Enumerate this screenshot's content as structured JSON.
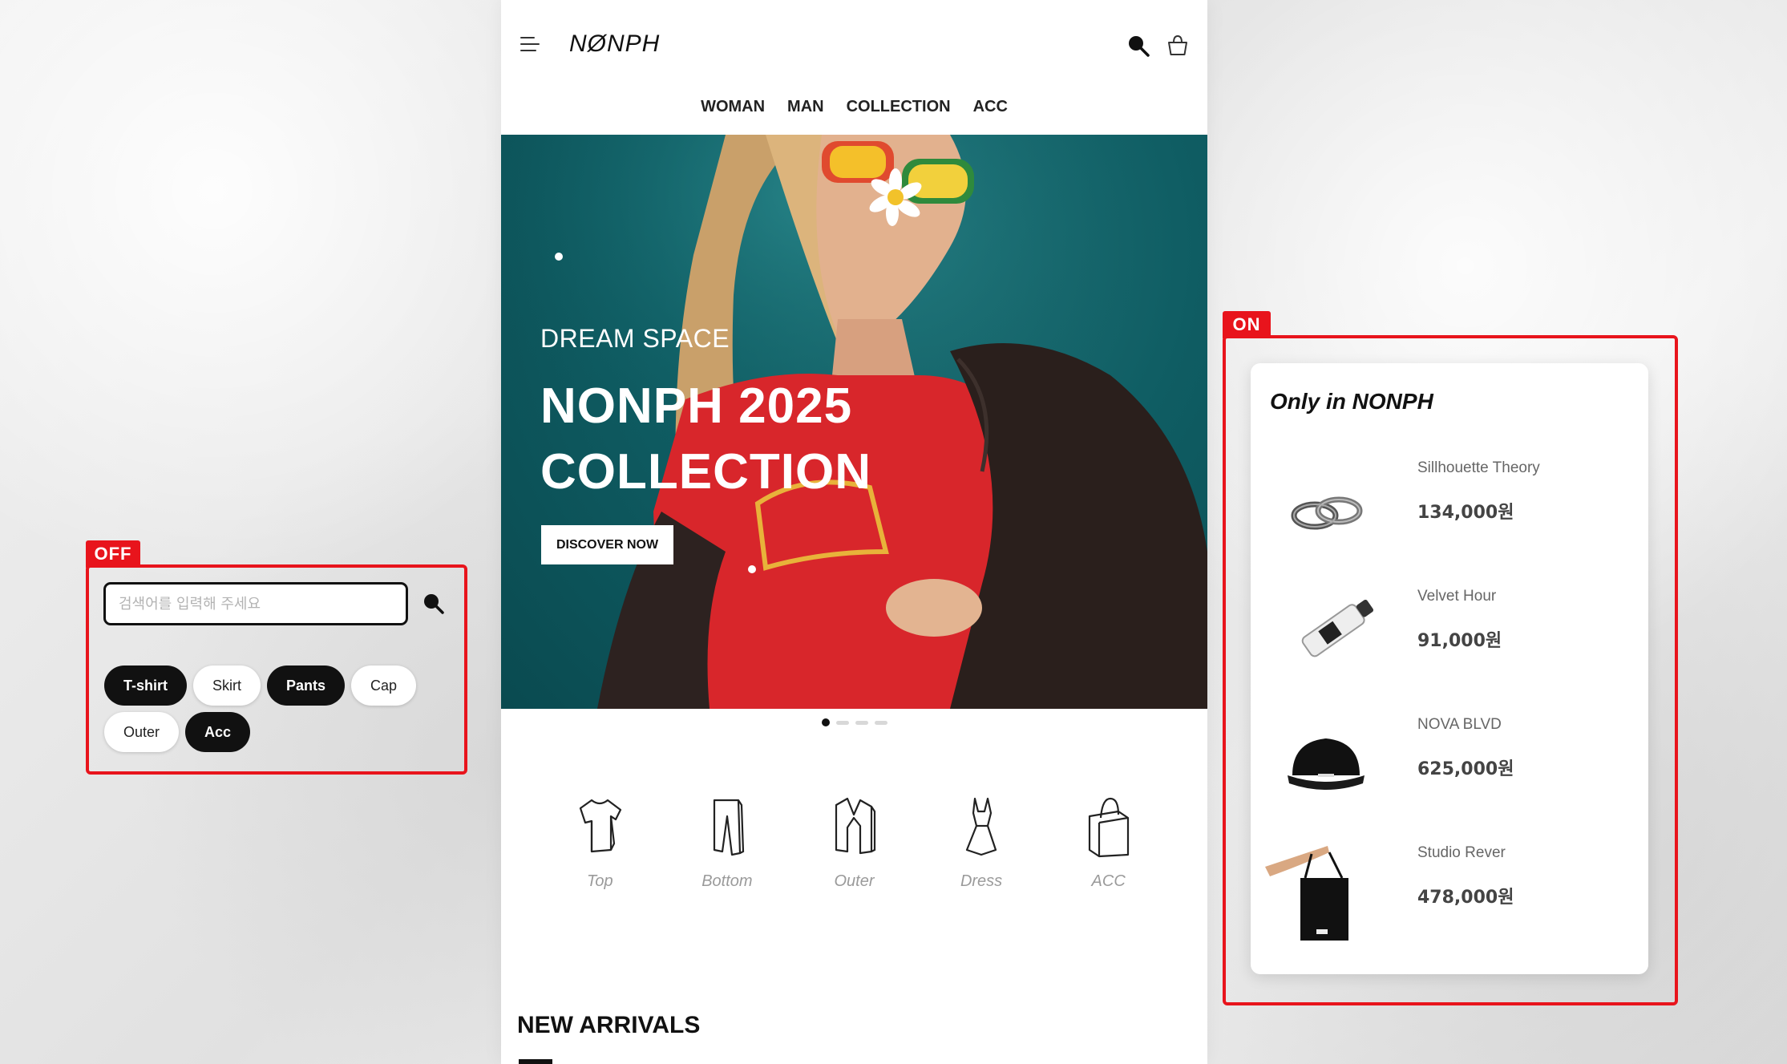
{
  "header": {
    "logo": "NØNPH",
    "nav": [
      "WOMAN",
      "MAN",
      "COLLECTION",
      "ACC"
    ]
  },
  "hero": {
    "subtitle": "DREAM SPACE",
    "title_line1": "NONPH 2025",
    "title_line2": "COLLECTION",
    "cta": "DISCOVER NOW",
    "slide_count": 4,
    "active_slide": 1
  },
  "categories": [
    {
      "label": "Top",
      "icon": "tshirt-icon"
    },
    {
      "label": "Bottom",
      "icon": "pants-icon"
    },
    {
      "label": "Outer",
      "icon": "jacket-icon"
    },
    {
      "label": "Dress",
      "icon": "dress-icon"
    },
    {
      "label": "ACC",
      "icon": "bag-icon"
    }
  ],
  "sections": {
    "new_arrivals": "NEW ARRIVALS"
  },
  "off_panel": {
    "tag": "OFF",
    "search_placeholder": "검색어를 입력해 주세요",
    "chips": [
      {
        "label": "T-shirt",
        "active": true
      },
      {
        "label": "Skirt",
        "active": false
      },
      {
        "label": "Pants",
        "active": true
      },
      {
        "label": "Cap",
        "active": false
      },
      {
        "label": "Outer",
        "active": false
      },
      {
        "label": "Acc",
        "active": true
      }
    ]
  },
  "on_panel": {
    "tag": "ON",
    "title": "Only in NONPH",
    "products": [
      {
        "name": "Sillhouette Theory",
        "price": "134,000원",
        "image": "rings"
      },
      {
        "name": "Velvet Hour",
        "price": "91,000원",
        "image": "oil-bottle"
      },
      {
        "name": "NOVA BLVD",
        "price": "625,000원",
        "image": "black-cap"
      },
      {
        "name": "Studio Rever",
        "price": "478,000원",
        "image": "tote-bag"
      }
    ]
  },
  "colors": {
    "annotation_red": "#e8141c",
    "hero_teal": "#0f5d63",
    "chip_active": "#111111"
  }
}
